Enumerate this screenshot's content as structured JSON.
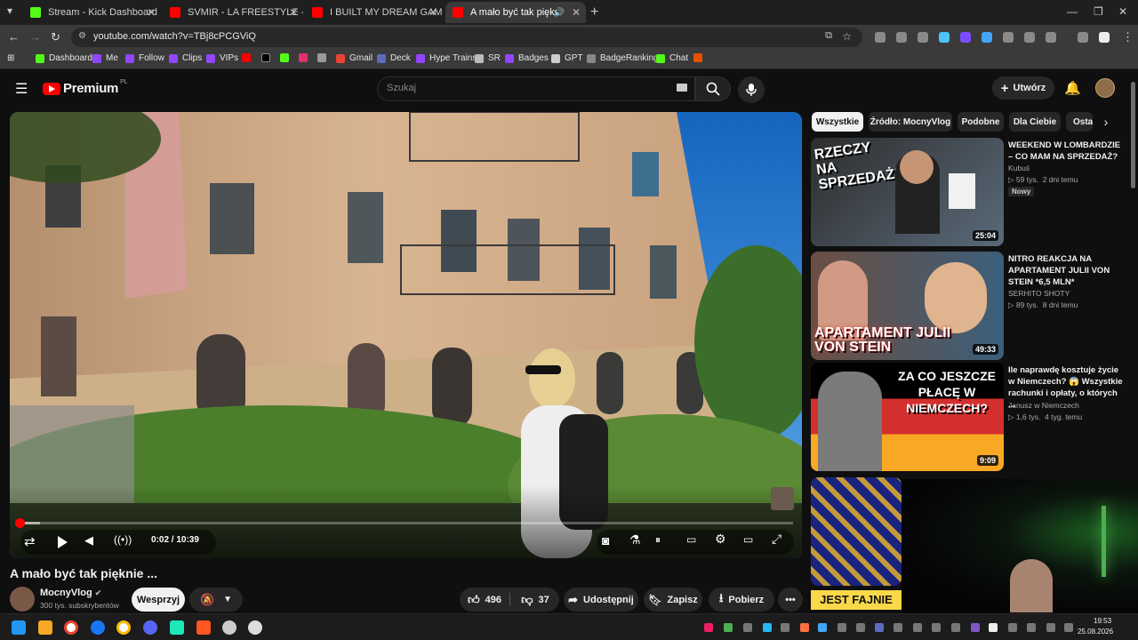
{
  "browser": {
    "tabs": [
      {
        "title": "Stream - Kick Dashboard",
        "favicon_color": "#53fc18"
      },
      {
        "title": "SVMIR - LA FREESTYLE - YouTu",
        "favicon_color": "#ff0000"
      },
      {
        "title": "I BUILT MY DREAM GAMING RO",
        "favicon_color": "#ff0000"
      },
      {
        "title": "A mało być tak pięknie -",
        "favicon_color": "#ff0000"
      }
    ],
    "url": "youtube.com/watch?v=TBj8cPCGViQ",
    "bookmarks": [
      "Dashboard",
      "Me",
      "Follow",
      "Clips",
      "VIPs",
      "",
      "",
      "",
      "",
      "",
      "Gmail",
      "Deck",
      "Hype Trains",
      "SR",
      "Badges",
      "GPT",
      "BadgeRanking",
      "Chat",
      ""
    ]
  },
  "youtube": {
    "logo_text": "Premium",
    "logo_region": "PL",
    "search_placeholder": "Szukaj",
    "create_label": "Utwórz"
  },
  "player": {
    "current_time": "0:02",
    "duration": "10:39",
    "time_display": "0:02 / 10:39",
    "progress_fraction": 0.003
  },
  "video": {
    "title": "A mało być tak pięknie ...",
    "channel": "MocnyVlog",
    "subscribers": "300 tys. subskrybentów",
    "support_label": "Wesprzyj",
    "likes": "496",
    "dislikes": "37",
    "share_label": "Udostępnij",
    "save_label": "Zapisz",
    "download_label": "Pobierz"
  },
  "sidebar": {
    "chips": [
      "Wszystkie",
      "Źródło: MocnyVlog",
      "Podobne",
      "Dla Ciebie",
      "Ostat"
    ],
    "recommendations": [
      {
        "title": "WEEKEND W LOMBARDZIE – CO MAM NA SPRZEDAŻ?",
        "channel": "Kubuś",
        "views": "59 tys.",
        "age": "2 dni temu",
        "badge": "Nowy",
        "duration": "25:04",
        "thumb_text": "RZECZY NA SPRZEDAŻ!"
      },
      {
        "title": "NITRO REAKCJA NA APARTAMENT JULII VON STEIN *6,5 MLN*",
        "channel": "SERHITO SHOTY",
        "views": "89 tys.",
        "age": "8 dni temu",
        "badge": "",
        "duration": "49:33",
        "thumb_text": "APARTAMENT JULII VON STEIN"
      },
      {
        "title": "Ile naprawdę kosztuje życie w Niemczech? 😱 Wszystkie rachunki i opłaty, o których ...",
        "channel": "Janusz w Niemczech",
        "views": "1,6 tys.",
        "age": "4 tyg. temu",
        "badge": "",
        "duration": "9:09",
        "thumb_text": "ZA CO JESZCZE PŁACĘ W NIEMCZECH?"
      },
      {
        "title": "",
        "channel": "",
        "views": "",
        "age": "",
        "badge": "",
        "duration": "",
        "thumb_text": "JEST FAJNIE"
      }
    ]
  },
  "taskbar": {
    "time": "19:53",
    "date": "25.08.2026"
  }
}
